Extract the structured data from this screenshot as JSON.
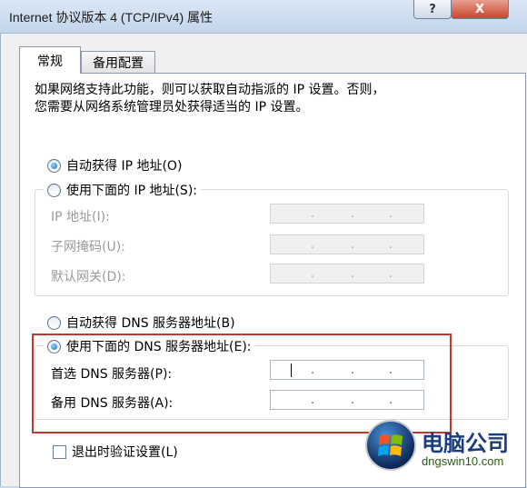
{
  "window": {
    "title": "Internet 协议版本 4 (TCP/IPv4) 属性",
    "help_button": "?",
    "close_button": "X"
  },
  "tabs": [
    {
      "label": "常规",
      "selected": true
    },
    {
      "label": "备用配置",
      "selected": false
    }
  ],
  "description": {
    "line1": "如果网络支持此功能，则可以获取自动指派的 IP 设置。否则，",
    "line2": "您需要从网络系统管理员处获得适当的 IP 设置。"
  },
  "ip_section": {
    "auto_option": "自动获得 IP 地址(O)",
    "auto_selected": true,
    "manual_option": "使用下面的 IP 地址(S):",
    "manual_selected": false,
    "fields": [
      {
        "label": "IP 地址(I):",
        "value": ". . ."
      },
      {
        "label": "子网掩码(U):",
        "value": ". . ."
      },
      {
        "label": "默认网关(D):",
        "value": ". . ."
      }
    ]
  },
  "dns_section": {
    "auto_option": "自动获得 DNS 服务器地址(B)",
    "auto_selected": false,
    "manual_option": "使用下面的 DNS 服务器地址(E):",
    "manual_selected": true,
    "fields": [
      {
        "label": "首选 DNS 服务器(P):",
        "value": ". . ."
      },
      {
        "label": "备用 DNS 服务器(A):",
        "value": ". . ."
      }
    ],
    "highlight_color": "#c0392b"
  },
  "validate_checkbox": {
    "label": "退出时验证设置(L)",
    "checked": false
  },
  "watermark": {
    "brand": "电脑公司",
    "url": "dngswin10.com"
  },
  "colors": {
    "titlebar": "#c9d8ea",
    "close_button": "#c9452f",
    "radio_selected": "#1c6fc8"
  }
}
